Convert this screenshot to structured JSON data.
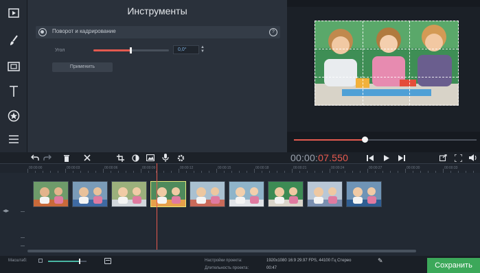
{
  "tools": {
    "title": "Инструменты",
    "section_label": "Поворот и кадрирование",
    "angle_label": "Угол",
    "angle_value": "0,0°",
    "angle_level": 0.5,
    "apply_label": "Применить"
  },
  "left_toolbar": [
    "film-icon",
    "brush-icon",
    "clip-split-icon",
    "text-icon",
    "star-icon",
    "menu-icon"
  ],
  "preview": {
    "seek_progress": 0.39
  },
  "timecode": {
    "main": "00:00:",
    "frac": "07.550"
  },
  "ruler": [
    "00:00:00",
    "00:00:03",
    "00:00:06",
    "00:00:09",
    "00:00:12",
    "00:00:15",
    "00:00:18",
    "00:00:21",
    "00:00:24",
    "00:00:27",
    "00:00:30",
    "00:00:33"
  ],
  "timeline": {
    "clip_count": 9,
    "active_clip": 3
  },
  "status": {
    "scale_label": "Масштаб:",
    "zoom_level": 0.82,
    "settings_key": "Настройки проекта:",
    "settings_val": "1920x1080 16:9 29.97 FPS, 44100 Гц Стерео",
    "duration_key": "Длительность проекта:",
    "duration_val": "00:47",
    "save_label": "Сохранить"
  },
  "colors": {
    "accent": "#e85a4f",
    "save": "#3ca85a",
    "zoom": "#49b6a3"
  }
}
